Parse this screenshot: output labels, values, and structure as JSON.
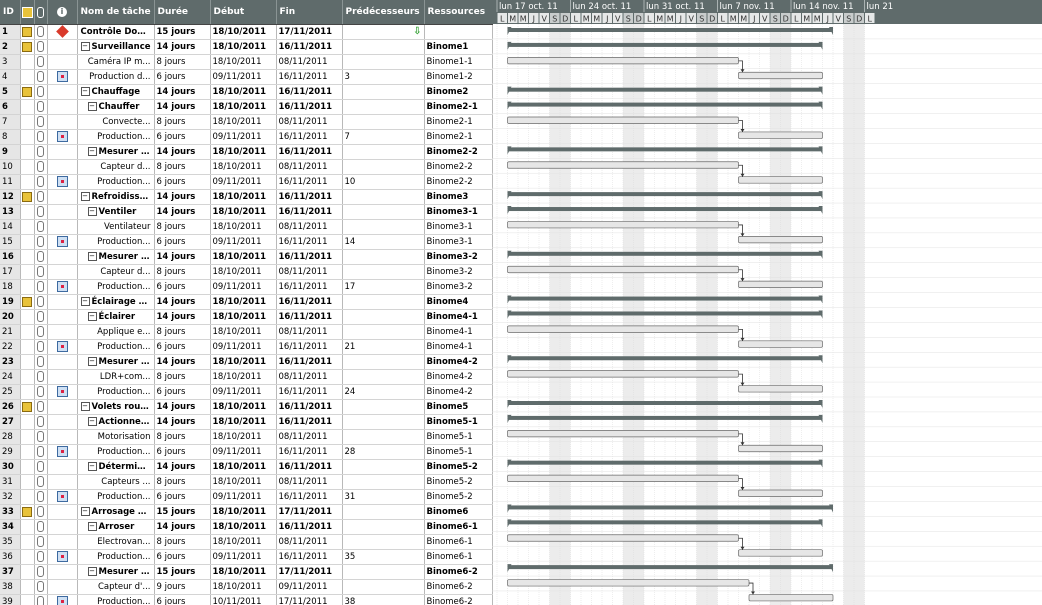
{
  "columns": {
    "id": "ID",
    "task_name": "Nom de tâche",
    "duration": "Durée",
    "start": "Début",
    "finish": "Fin",
    "predecessors": "Prédécesseurs",
    "resources": "Ressources"
  },
  "timeline": {
    "weeks": [
      "lun 17 oct. 11",
      "lun 24 oct. 11",
      "lun 31 oct. 11",
      "lun 7 nov. 11",
      "lun 14 nov. 11",
      "lun 21"
    ],
    "days": [
      "L",
      "M",
      "M",
      "J",
      "V",
      "S",
      "D",
      "L",
      "M",
      "M",
      "J",
      "V",
      "S",
      "D",
      "L",
      "M",
      "M",
      "J",
      "V",
      "S",
      "D",
      "L",
      "M",
      "M",
      "J",
      "V",
      "S",
      "D",
      "L",
      "M",
      "M",
      "J",
      "V",
      "S",
      "D",
      "L"
    ]
  },
  "tasks": [
    {
      "id": "1",
      "level": 0,
      "summary": true,
      "name": "Contrôle Domo...",
      "duration": "15 jours",
      "start": "18/10/2011",
      "finish": "17/11/2011",
      "pred": "",
      "res": "",
      "icon": "note"
    },
    {
      "id": "2",
      "level": 1,
      "summary": true,
      "name": "Surveillance",
      "duration": "14 jours",
      "start": "18/10/2011",
      "finish": "16/11/2011",
      "pred": "",
      "res": "Binome1",
      "icon": "note"
    },
    {
      "id": "3",
      "level": 3,
      "summary": false,
      "name": "Caméra IP m...",
      "duration": "8 jours",
      "start": "18/10/2011",
      "finish": "08/11/2011",
      "pred": "",
      "res": "Binome1-1",
      "icon": ""
    },
    {
      "id": "4",
      "level": 3,
      "summary": false,
      "name": "Production d...",
      "duration": "6 jours",
      "start": "09/11/2011",
      "finish": "16/11/2011",
      "pred": "3",
      "res": "Binome1-2",
      "icon": "cal"
    },
    {
      "id": "5",
      "level": 1,
      "summary": true,
      "name": "Chauffage",
      "duration": "14 jours",
      "start": "18/10/2011",
      "finish": "16/11/2011",
      "pred": "",
      "res": "Binome2",
      "icon": "note"
    },
    {
      "id": "6",
      "level": 2,
      "summary": true,
      "name": "Chauffer",
      "duration": "14 jours",
      "start": "18/10/2011",
      "finish": "16/11/2011",
      "pred": "",
      "res": "Binome2-1",
      "icon": ""
    },
    {
      "id": "7",
      "level": 3,
      "summary": false,
      "name": "Convecte...",
      "duration": "8 jours",
      "start": "18/10/2011",
      "finish": "08/11/2011",
      "pred": "",
      "res": "Binome2-1",
      "icon": ""
    },
    {
      "id": "8",
      "level": 3,
      "summary": false,
      "name": "Production...",
      "duration": "6 jours",
      "start": "09/11/2011",
      "finish": "16/11/2011",
      "pred": "7",
      "res": "Binome2-1",
      "icon": "cal"
    },
    {
      "id": "9",
      "level": 2,
      "summary": true,
      "name": "Mesurer la ...",
      "duration": "14 jours",
      "start": "18/10/2011",
      "finish": "16/11/2011",
      "pred": "",
      "res": "Binome2-2",
      "icon": ""
    },
    {
      "id": "10",
      "level": 3,
      "summary": false,
      "name": "Capteur d...",
      "duration": "8 jours",
      "start": "18/10/2011",
      "finish": "08/11/2011",
      "pred": "",
      "res": "Binome2-2",
      "icon": ""
    },
    {
      "id": "11",
      "level": 3,
      "summary": false,
      "name": "Production...",
      "duration": "6 jours",
      "start": "09/11/2011",
      "finish": "16/11/2011",
      "pred": "10",
      "res": "Binome2-2",
      "icon": "cal"
    },
    {
      "id": "12",
      "level": 1,
      "summary": true,
      "name": "Refroidissem...",
      "duration": "14 jours",
      "start": "18/10/2011",
      "finish": "16/11/2011",
      "pred": "",
      "res": "Binome3",
      "icon": "note"
    },
    {
      "id": "13",
      "level": 2,
      "summary": true,
      "name": "Ventiler",
      "duration": "14 jours",
      "start": "18/10/2011",
      "finish": "16/11/2011",
      "pred": "",
      "res": "Binome3-1",
      "icon": ""
    },
    {
      "id": "14",
      "level": 3,
      "summary": false,
      "name": "Ventilateur",
      "duration": "8 jours",
      "start": "18/10/2011",
      "finish": "08/11/2011",
      "pred": "",
      "res": "Binome3-1",
      "icon": ""
    },
    {
      "id": "15",
      "level": 3,
      "summary": false,
      "name": "Production...",
      "duration": "6 jours",
      "start": "09/11/2011",
      "finish": "16/11/2011",
      "pred": "14",
      "res": "Binome3-1",
      "icon": "cal"
    },
    {
      "id": "16",
      "level": 2,
      "summary": true,
      "name": "Mesurer la ...",
      "duration": "14 jours",
      "start": "18/10/2011",
      "finish": "16/11/2011",
      "pred": "",
      "res": "Binome3-2",
      "icon": ""
    },
    {
      "id": "17",
      "level": 3,
      "summary": false,
      "name": "Capteur d...",
      "duration": "8 jours",
      "start": "18/10/2011",
      "finish": "08/11/2011",
      "pred": "",
      "res": "Binome3-2",
      "icon": ""
    },
    {
      "id": "18",
      "level": 3,
      "summary": false,
      "name": "Production...",
      "duration": "6 jours",
      "start": "09/11/2011",
      "finish": "16/11/2011",
      "pred": "17",
      "res": "Binome3-2",
      "icon": "cal"
    },
    {
      "id": "19",
      "level": 1,
      "summary": true,
      "name": "Éclairage ext...",
      "duration": "14 jours",
      "start": "18/10/2011",
      "finish": "16/11/2011",
      "pred": "",
      "res": "Binome4",
      "icon": "note"
    },
    {
      "id": "20",
      "level": 2,
      "summary": true,
      "name": "Éclairer",
      "duration": "14 jours",
      "start": "18/10/2011",
      "finish": "16/11/2011",
      "pred": "",
      "res": "Binome4-1",
      "icon": ""
    },
    {
      "id": "21",
      "level": 3,
      "summary": false,
      "name": "Applique e...",
      "duration": "8 jours",
      "start": "18/10/2011",
      "finish": "08/11/2011",
      "pred": "",
      "res": "Binome4-1",
      "icon": ""
    },
    {
      "id": "22",
      "level": 3,
      "summary": false,
      "name": "Production...",
      "duration": "6 jours",
      "start": "09/11/2011",
      "finish": "16/11/2011",
      "pred": "21",
      "res": "Binome4-1",
      "icon": "cal"
    },
    {
      "id": "23",
      "level": 2,
      "summary": true,
      "name": "Mesurer la ...",
      "duration": "14 jours",
      "start": "18/10/2011",
      "finish": "16/11/2011",
      "pred": "",
      "res": "Binome4-2",
      "icon": ""
    },
    {
      "id": "24",
      "level": 3,
      "summary": false,
      "name": "LDR+com...",
      "duration": "8 jours",
      "start": "18/10/2011",
      "finish": "08/11/2011",
      "pred": "",
      "res": "Binome4-2",
      "icon": ""
    },
    {
      "id": "25",
      "level": 3,
      "summary": false,
      "name": "Production...",
      "duration": "6 jours",
      "start": "09/11/2011",
      "finish": "16/11/2011",
      "pred": "24",
      "res": "Binome4-2",
      "icon": "cal"
    },
    {
      "id": "26",
      "level": 1,
      "summary": true,
      "name": "Volets roulants",
      "duration": "14 jours",
      "start": "18/10/2011",
      "finish": "16/11/2011",
      "pred": "",
      "res": "Binome5",
      "icon": "note"
    },
    {
      "id": "27",
      "level": 2,
      "summary": true,
      "name": "Actionner l...",
      "duration": "14 jours",
      "start": "18/10/2011",
      "finish": "16/11/2011",
      "pred": "",
      "res": "Binome5-1",
      "icon": ""
    },
    {
      "id": "28",
      "level": 3,
      "summary": false,
      "name": "Motorisation",
      "duration": "8 jours",
      "start": "18/10/2011",
      "finish": "08/11/2011",
      "pred": "",
      "res": "Binome5-1",
      "icon": ""
    },
    {
      "id": "29",
      "level": 3,
      "summary": false,
      "name": "Production...",
      "duration": "6 jours",
      "start": "09/11/2011",
      "finish": "16/11/2011",
      "pred": "28",
      "res": "Binome5-1",
      "icon": "cal"
    },
    {
      "id": "30",
      "level": 2,
      "summary": true,
      "name": "Déterminer...",
      "duration": "14 jours",
      "start": "18/10/2011",
      "finish": "16/11/2011",
      "pred": "",
      "res": "Binome5-2",
      "icon": ""
    },
    {
      "id": "31",
      "level": 3,
      "summary": false,
      "name": "Capteurs ...",
      "duration": "8 jours",
      "start": "18/10/2011",
      "finish": "08/11/2011",
      "pred": "",
      "res": "Binome5-2",
      "icon": ""
    },
    {
      "id": "32",
      "level": 3,
      "summary": false,
      "name": "Production...",
      "duration": "6 jours",
      "start": "09/11/2011",
      "finish": "16/11/2011",
      "pred": "31",
      "res": "Binome5-2",
      "icon": "cal"
    },
    {
      "id": "33",
      "level": 1,
      "summary": true,
      "name": "Arrosage aut...",
      "duration": "15 jours",
      "start": "18/10/2011",
      "finish": "17/11/2011",
      "pred": "",
      "res": "Binome6",
      "icon": "note"
    },
    {
      "id": "34",
      "level": 2,
      "summary": true,
      "name": "Arroser",
      "duration": "14 jours",
      "start": "18/10/2011",
      "finish": "16/11/2011",
      "pred": "",
      "res": "Binome6-1",
      "icon": ""
    },
    {
      "id": "35",
      "level": 3,
      "summary": false,
      "name": "Electrovan...",
      "duration": "8 jours",
      "start": "18/10/2011",
      "finish": "08/11/2011",
      "pred": "",
      "res": "Binome6-1",
      "icon": ""
    },
    {
      "id": "36",
      "level": 3,
      "summary": false,
      "name": "Production...",
      "duration": "6 jours",
      "start": "09/11/2011",
      "finish": "16/11/2011",
      "pred": "35",
      "res": "Binome6-1",
      "icon": "cal"
    },
    {
      "id": "37",
      "level": 2,
      "summary": true,
      "name": "Mesurer l'...",
      "duration": "15 jours",
      "start": "18/10/2011",
      "finish": "17/11/2011",
      "pred": "",
      "res": "Binome6-2",
      "icon": ""
    },
    {
      "id": "38",
      "level": 3,
      "summary": false,
      "name": "Capteur d'...",
      "duration": "9 jours",
      "start": "18/10/2011",
      "finish": "09/11/2011",
      "pred": "",
      "res": "Binome6-2",
      "icon": ""
    },
    {
      "id": "39",
      "level": 3,
      "summary": false,
      "name": "Production...",
      "duration": "6 jours",
      "start": "10/11/2011",
      "finish": "17/11/2011",
      "pred": "38",
      "res": "Binome6-2",
      "icon": "cal"
    }
  ],
  "colors": {
    "header_bg": "#5f6b6b",
    "summary_bar": "#5f6b6b",
    "task_bar": "#e6e6e6",
    "weekend": "#e8e8e8",
    "id_col": "#e6e6e6"
  },
  "icons": {
    "header_type": "note-icon",
    "header_attach": "paperclip-icon",
    "header_info": "info-icon",
    "row1_indicator": "warning-icon",
    "row1_pred": "green-arrow-down-icon"
  }
}
